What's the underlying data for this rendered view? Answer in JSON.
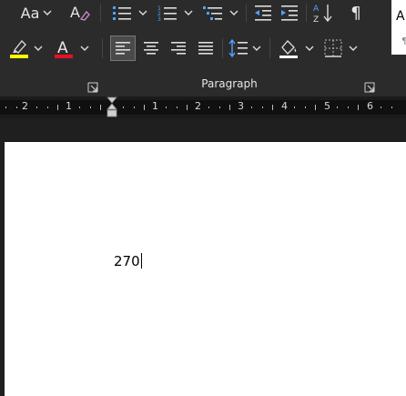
{
  "ribbon": {
    "font": {
      "change_case_label": "Aa",
      "font_color_letter": "A"
    },
    "paragraph": {
      "group_label": "Paragraph",
      "pilcrow": "¶"
    },
    "styles_partial": {
      "preview_letter": "A"
    }
  },
  "colors": {
    "highlight": "#ffff00",
    "font_color": "#e81123",
    "ribbon_bg": "#2b2b2b",
    "page_bg": "#ffffff"
  },
  "ruler": {
    "labels": [
      "2",
      "1",
      "1",
      "2",
      "3",
      "4",
      "5",
      "6"
    ]
  },
  "document": {
    "text": "270"
  }
}
